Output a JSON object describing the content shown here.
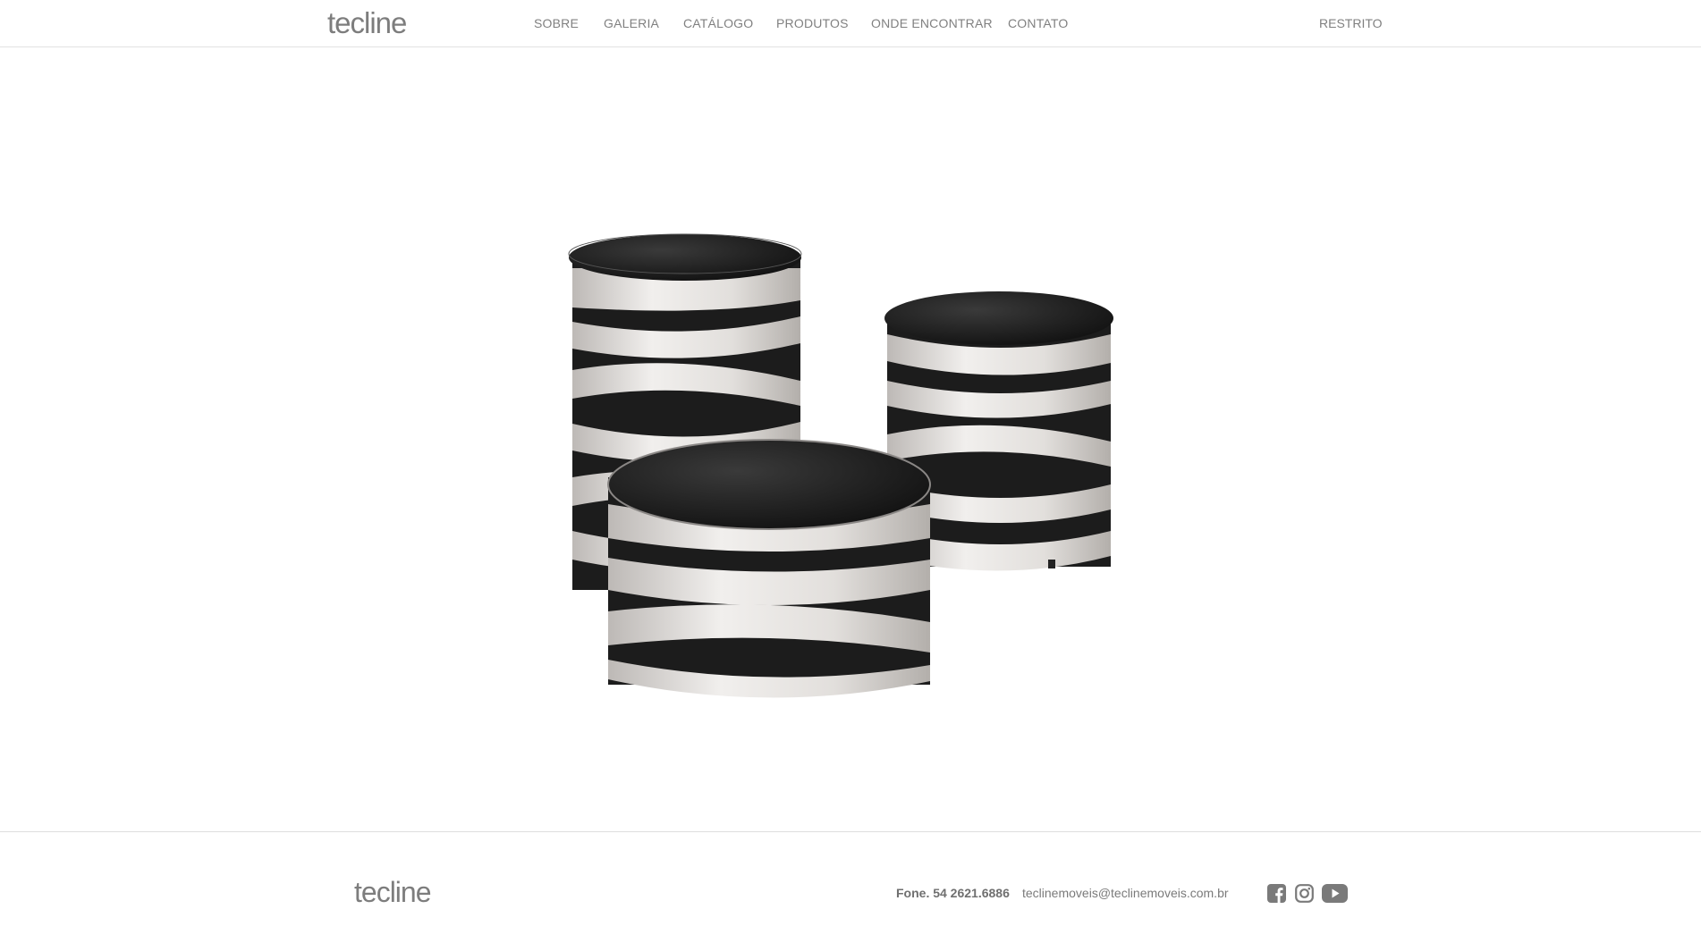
{
  "header": {
    "logo": "tecline",
    "nav": [
      {
        "label": "SOBRE"
      },
      {
        "label": "GALERIA"
      },
      {
        "label": "CATÁLOGO"
      },
      {
        "label": "PRODUTOS"
      },
      {
        "label": "ONDE ENCONTRAR"
      },
      {
        "label": "CONTATO"
      }
    ],
    "restricted": "RESTRITO"
  },
  "hero": {
    "image": "product-photo-round-side-tables-black-glass-tops"
  },
  "footer": {
    "logo": "tecline",
    "phone": "Fone. 54 2621.6886",
    "email": "teclinemoveis@teclinemoveis.com.br",
    "social": [
      {
        "icon": "facebook-icon"
      },
      {
        "icon": "instagram-icon"
      },
      {
        "icon": "youtube-icon"
      }
    ]
  },
  "colors": {
    "text": "#808080",
    "border": "#e2e2e2",
    "icon": "#7a7a7a"
  }
}
